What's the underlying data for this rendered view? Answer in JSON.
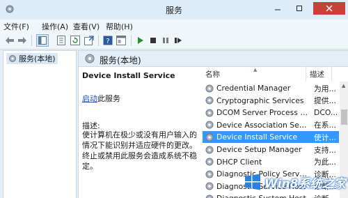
{
  "window": {
    "title": "服务"
  },
  "menu": [
    "文件(F)",
    "操作(A)",
    "查看(V)",
    "帮助(H)"
  ],
  "tree": {
    "root_label": "服务(本地)"
  },
  "pane": {
    "header_title": "服务(本地)"
  },
  "detail": {
    "service_name": "Device Install Service",
    "start_link": "启动",
    "start_suffix": "此服务",
    "desc_label": "描述:",
    "desc_text": "使计算机在极少或没有用户输入的情况下能识别并适应硬件的更改。终止或禁用此服务会造成系统不稳定。"
  },
  "list": {
    "col_name": "名称",
    "col_desc": "描述",
    "rows": [
      {
        "name": "Credential Manager",
        "desc": "为用..."
      },
      {
        "name": "Cryptographic Services",
        "desc": "提供..."
      },
      {
        "name": "DCOM Server Process La...",
        "desc": "DCO..."
      },
      {
        "name": "Device Association Service",
        "desc": "在系..."
      },
      {
        "name": "Device Install Service",
        "desc": "使计..."
      },
      {
        "name": "Device Setup Manager",
        "desc": "支持..."
      },
      {
        "name": "DHCP Client",
        "desc": "为此..."
      },
      {
        "name": "Diagnostic Policy Service",
        "desc": "诊断..."
      },
      {
        "name": "Diagnostic Service Host",
        "desc": "诊断..."
      },
      {
        "name": "Diagnostic System Host",
        "desc": "诊断..."
      }
    ],
    "selected_index": 4
  },
  "watermark": {
    "text": "Win8系统之家"
  }
}
